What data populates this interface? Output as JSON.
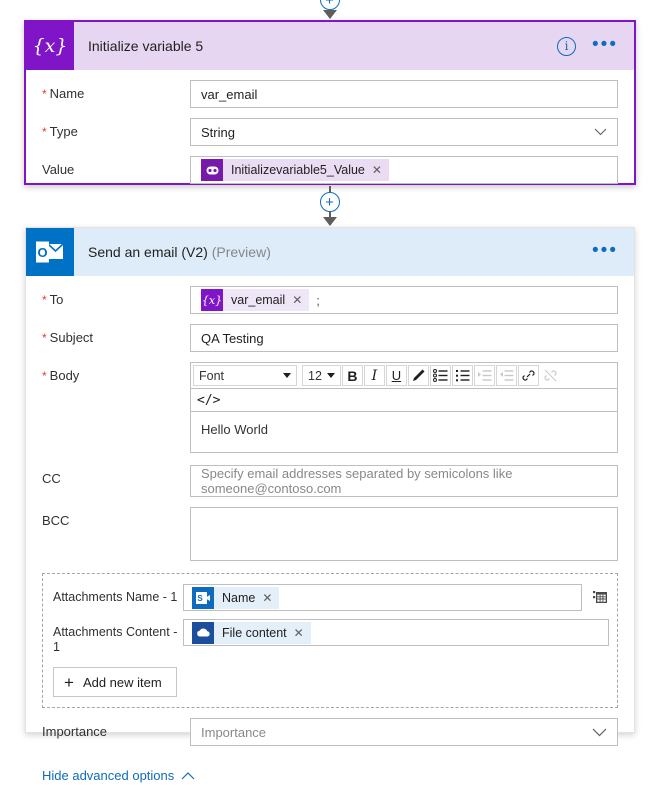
{
  "connectors": {
    "top_arrow": "arrow-down",
    "insert_label": "+"
  },
  "init_variable_card": {
    "icon": "variable-braces-icon",
    "icon_glyph": "{x}",
    "title": "Initialize variable 5",
    "info_icon": "i",
    "menu_icon": "•••",
    "accent_color": "#8015c8",
    "header_bg": "#e6d6f2",
    "fields": [
      {
        "label": "Name",
        "required": true,
        "value": "var_email",
        "type": "text"
      },
      {
        "label": "Type",
        "required": true,
        "value": "String",
        "type": "select"
      },
      {
        "label": "Value",
        "required": false,
        "type": "token",
        "token": {
          "text": "Initializevariable5_Value",
          "icon": "variable-token-icon",
          "remove": "✕"
        }
      }
    ]
  },
  "email_card": {
    "icon": "outlook-icon",
    "title": "Send an email (V2)",
    "preview_tag": "(Preview)",
    "menu_icon": "•••",
    "accent_color": "#0072c6",
    "header_bg": "#deecf9",
    "to": {
      "label": "To",
      "required": true,
      "token": {
        "text": "var_email",
        "icon": "variable-braces-icon",
        "glyph": "{x}",
        "remove": "✕"
      },
      "trailing": ";"
    },
    "subject": {
      "label": "Subject",
      "required": true,
      "value": "QA Testing"
    },
    "body": {
      "label": "Body",
      "required": true,
      "value": "Hello World",
      "toolbar": {
        "font_label": "Font",
        "size_label": "12",
        "bold": "B",
        "italic": "I",
        "underline": "U",
        "pen": "pen-icon",
        "bullet_list": "bulleted-list-icon",
        "number_list": "numbered-list-icon",
        "indent_increase": "indent-increase-icon",
        "indent_decrease": "indent-decrease-icon",
        "link": "link-icon",
        "unlink": "unlink-icon"
      },
      "code_view": "</>"
    },
    "cc": {
      "label": "CC",
      "placeholder": "Specify email addresses separated by semicolons like someone@contoso.com"
    },
    "bcc": {
      "label": "BCC",
      "value": ""
    },
    "attachments": {
      "name_label": "Attachments Name - 1",
      "name_token": {
        "text": "Name",
        "icon": "sharepoint-icon",
        "remove": "✕"
      },
      "content_label": "Attachments Content - 1",
      "content_token": {
        "text": "File content",
        "icon": "onedrive-cloud-icon",
        "remove": "✕"
      },
      "delete_icon": "delete-item-icon",
      "add_item_label": "Add new item",
      "add_item_icon": "plus-icon"
    },
    "importance": {
      "label": "Importance",
      "placeholder": "Importance"
    },
    "advanced_link": {
      "text": "Hide advanced options",
      "icon": "chevron-up-icon"
    }
  }
}
